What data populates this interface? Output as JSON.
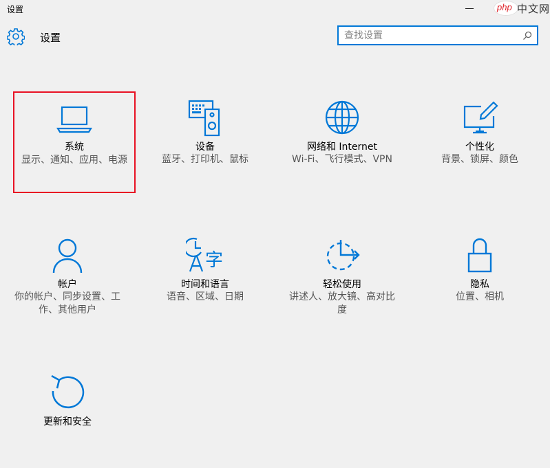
{
  "window": {
    "title": "设置"
  },
  "watermark": {
    "php": "php",
    "cn": "中文网"
  },
  "header": {
    "title": "设置"
  },
  "search": {
    "placeholder": "查找设置"
  },
  "tiles": [
    {
      "title": "系统",
      "desc": "显示、通知、应用、电源",
      "icon": "laptop-icon"
    },
    {
      "title": "设备",
      "desc": "蓝牙、打印机、鼠标",
      "icon": "keyboard-speaker-icon"
    },
    {
      "title": "网络和 Internet",
      "desc": "Wi-Fi、飞行模式、VPN",
      "icon": "globe-icon"
    },
    {
      "title": "个性化",
      "desc": "背景、锁屏、颜色",
      "icon": "paint-monitor-icon"
    },
    {
      "title": "帐户",
      "desc": "你的帐户、同步设置、工作、其他用户",
      "icon": "person-icon"
    },
    {
      "title": "时间和语言",
      "desc": "语音、区域、日期",
      "icon": "clock-language-icon"
    },
    {
      "title": "轻松使用",
      "desc": "讲述人、放大镜、高对比度",
      "icon": "ease-of-access-icon"
    },
    {
      "title": "隐私",
      "desc": "位置、相机",
      "icon": "lock-icon"
    },
    {
      "title": "更新和安全",
      "desc": "",
      "icon": "sync-icon"
    }
  ],
  "colors": {
    "accent": "#0078d7",
    "selection": "#e81123",
    "background": "#f0f0f0"
  }
}
